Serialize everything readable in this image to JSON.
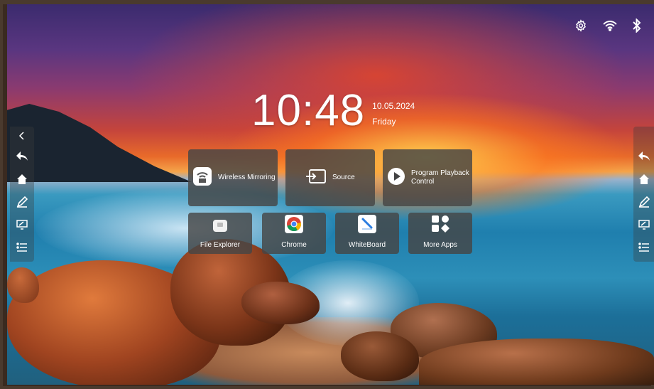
{
  "status_bar": {
    "icons": [
      "settings-gear-icon",
      "wifi-icon",
      "bluetooth-icon"
    ]
  },
  "clock": {
    "time": "10:48",
    "date": "10.05.2024",
    "day": "Friday"
  },
  "tiles_top": [
    {
      "label": "Wireless Mirroring",
      "icon": "wireless-mirroring-icon"
    },
    {
      "label": "Source",
      "icon": "source-input-icon"
    },
    {
      "label": "Program Playback Control",
      "icon": "play-icon"
    }
  ],
  "tiles_bottom": [
    {
      "label": "File Explorer",
      "icon": "folder-icon"
    },
    {
      "label": "Chrome",
      "icon": "chrome-icon"
    },
    {
      "label": "WhiteBoard",
      "icon": "whiteboard-icon"
    },
    {
      "label": "More Apps",
      "icon": "more-apps-grid-icon"
    }
  ],
  "left_sidebar": [
    "collapse-chevron-icon",
    "back-icon",
    "home-icon",
    "annotate-pen-icon",
    "screen-annotate-icon",
    "menu-list-icon"
  ],
  "right_sidebar": [
    "back-icon",
    "home-icon",
    "annotate-pen-icon",
    "screen-annotate-icon",
    "menu-list-icon"
  ],
  "colors": {
    "tile_bg": "#464646",
    "text": "#ffffff"
  }
}
